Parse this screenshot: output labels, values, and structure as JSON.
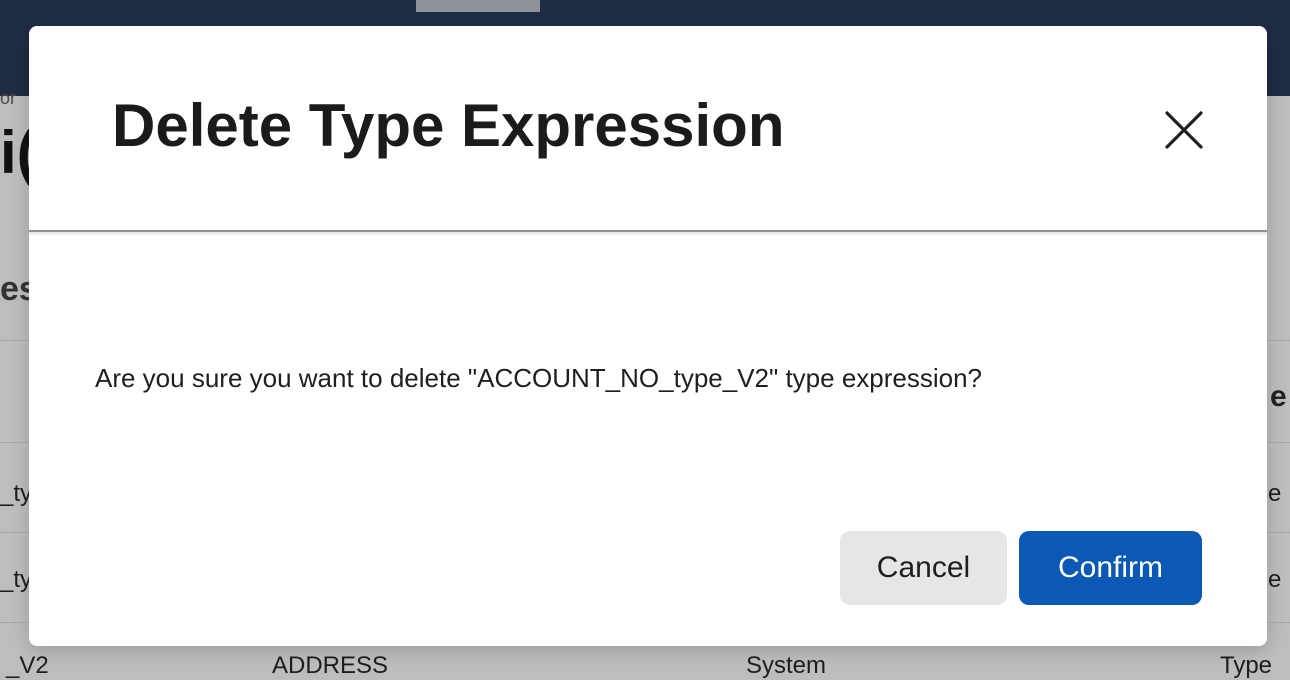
{
  "background": {
    "breadcrumb_fragment": "or",
    "title_fragment": "i(",
    "section_fragment": "es",
    "header_fragment": "e",
    "rows": [
      {
        "c1": "_ty",
        "c4": "e"
      },
      {
        "c1": "_ty",
        "c4": "e"
      },
      {
        "c1": "_V2",
        "c2": "ADDRESS",
        "c3": "System",
        "c4": "Type"
      }
    ]
  },
  "dialog": {
    "title": "Delete Type Expression",
    "close_icon": "close-icon",
    "message": "Are you sure you want to delete \"ACCOUNT_NO_type_V2\" type expression?",
    "cancel_label": "Cancel",
    "confirm_label": "Confirm"
  },
  "colors": {
    "topbar": "#1f2d45",
    "overlay": "#bdbdbd",
    "confirm_button": "#0b58b5",
    "cancel_button": "#e6e6e6"
  }
}
